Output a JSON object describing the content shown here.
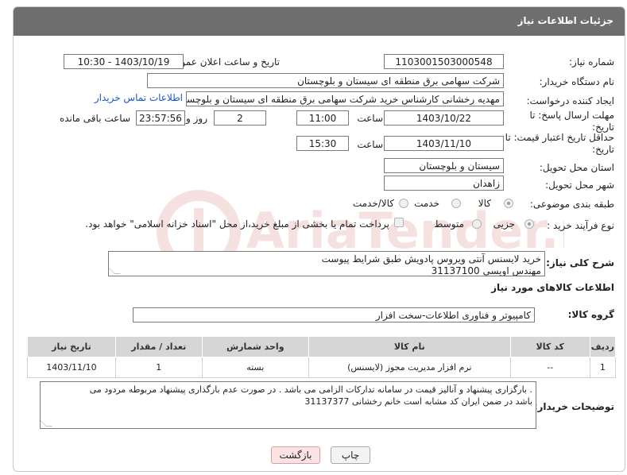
{
  "header": {
    "title": "جزئیات اطلاعات نیاز"
  },
  "form": {
    "need_number_label": "شماره نیاز:",
    "need_number": "1103001503000548",
    "announce_label": "تاریخ و ساعت اعلان عمومی:",
    "announce_value": "1403/10/19 - 10:30",
    "buyer_org_label": "نام دستگاه خریدار:",
    "buyer_org": "شرکت سهامی برق منطقه ای سیستان و بلوچستان",
    "creator_label": "ایجاد کننده درخواست:",
    "creator": "مهدیه رخشانی کارشناس خرید شرکت سهامی برق منطقه ای سیستان و بلوچستان",
    "contact_link": "اطلاعات تماس خریدار",
    "reply_deadline_label": "مهلت ارسال پاسخ: تا تاریخ:",
    "reply_date": "1403/10/22",
    "time_label": "ساعت",
    "reply_time": "11:00",
    "days_value": "2",
    "days_label": "روز و",
    "remaining_time": "23:57:56",
    "remaining_label": "ساعت باقی مانده",
    "validity_label": "حداقل تاریخ اعتبار قیمت: تا تاریخ:",
    "validity_date": "1403/11/10",
    "validity_time_label": "ساعت",
    "validity_time": "15:30",
    "province_label": "استان محل تحویل:",
    "province": "سیستان و بلوچستان",
    "city_label": "شهر محل تحویل:",
    "city": "زاهدان",
    "category_label": "طبقه بندی موضوعی:",
    "category_options": [
      "کالا",
      "خدمت",
      "کالا/خدمت"
    ],
    "process_label": "نوع فرآیند خرید :",
    "process_options": [
      "جزیی",
      "متوسط"
    ],
    "treasury_text": "پرداخت تمام یا بخشی از مبلغ خرید،از محل \"اسناد خزانه اسلامی\" خواهد بود.",
    "general_desc_label": "شرح کلی نیاز:",
    "general_desc_line1": "خرید لایسنس آنتی ویروس پادویش طبق شرایط پیوست",
    "general_desc_line2": "مهندس اویسی 31137100",
    "goods_info_title": "اطلاعات کالاهای مورد نیاز",
    "goods_group_label": "گروه کالا:",
    "goods_group": "کامپیوتر و فناوری اطلاعات-سخت افزار"
  },
  "table": {
    "headers": [
      "ردیف",
      "کد کالا",
      "نام کالا",
      "واحد شمارش",
      "تعداد / مقدار",
      "تاریخ نیاز"
    ],
    "rows": [
      [
        "1",
        "--",
        "نرم افزار مدیریت مجوز (لایسنس)",
        "بسته",
        "1",
        "1403/11/10"
      ]
    ]
  },
  "buyer_notes": {
    "label": "توضیحات خریدار:",
    "line1": ". بارگزاری پیشنهاد و آنالیز قیمت در سامانه تدارکات الزامی می باشد . در صورت عدم بارگذاری پیشنهاد مربوطه مردود می",
    "line2": "باشد در ضمن ایران کد مشابه است خانم رخشانی 31137377"
  },
  "buttons": {
    "print": "چاپ",
    "back": "بازگشت"
  },
  "watermark": {
    "text": "AriaTender.neT"
  },
  "colors": {
    "header_bg": "#6e6e6e",
    "link": "#1a56c9",
    "table_header": "#d6d6d6",
    "back_button": "#fbe3e3"
  }
}
